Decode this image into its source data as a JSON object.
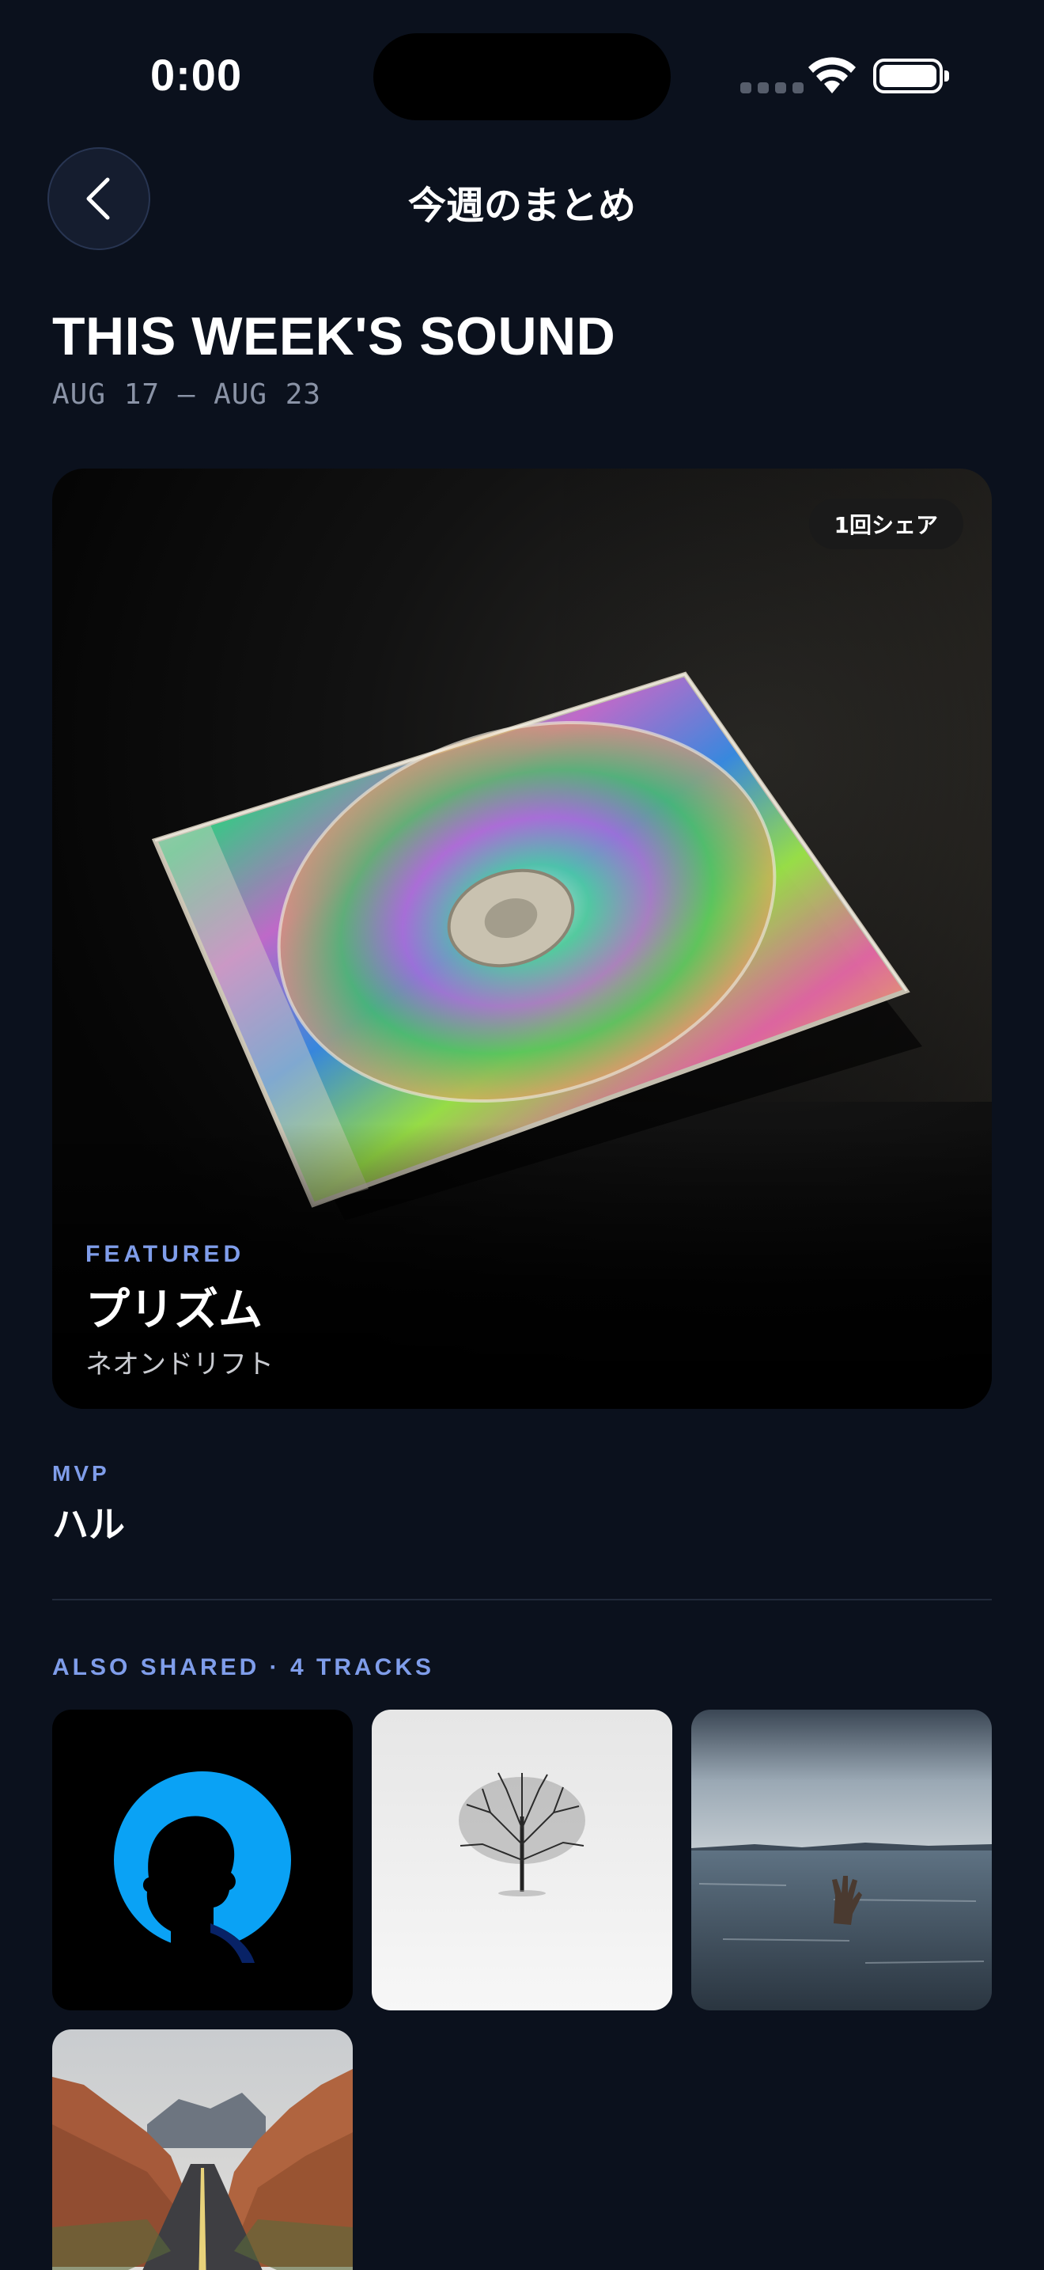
{
  "status_bar": {
    "time": "0:00"
  },
  "nav": {
    "title": "今週のまとめ"
  },
  "summary": {
    "heading": "THIS WEEK'S SOUND",
    "date_range": "AUG 17 — AUG 23"
  },
  "featured": {
    "share_badge": "1回シェア",
    "label": "FEATURED",
    "track": "プリズム",
    "artist": "ネオンドリフト"
  },
  "mvp": {
    "label": "MVP",
    "name": "ハル"
  },
  "also_shared": {
    "label": "ALSO SHARED · 4 TRACKS",
    "tracks": [
      {
        "art": "silhouette-blue-circle"
      },
      {
        "art": "lone-tree-snow"
      },
      {
        "art": "hand-in-sea"
      },
      {
        "art": "desert-road"
      }
    ]
  },
  "colors": {
    "background": "#0b111d",
    "accent": "#7f9dea"
  }
}
